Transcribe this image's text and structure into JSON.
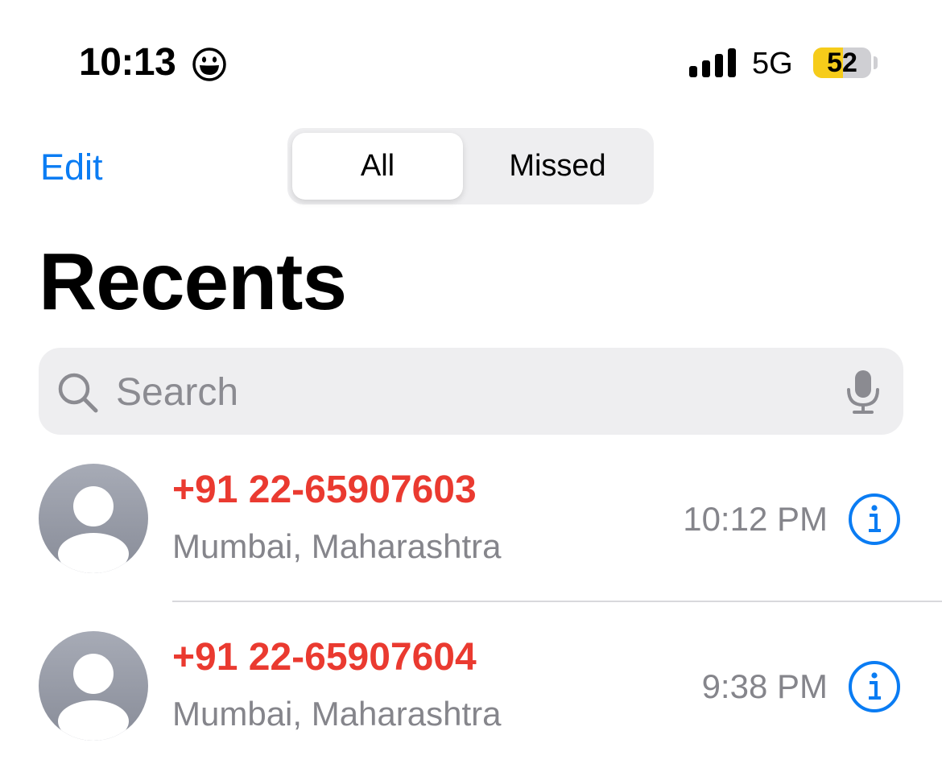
{
  "status_bar": {
    "time": "10:13",
    "status_emoji": "smiley-icon",
    "network": "5G",
    "battery": "52",
    "battery_level": 0.52
  },
  "nav": {
    "edit_label": "Edit",
    "segments": [
      {
        "label": "All",
        "selected": true
      },
      {
        "label": "Missed",
        "selected": false
      }
    ]
  },
  "title": "Recents",
  "search": {
    "placeholder": "Search",
    "icon": "search-icon",
    "mic_icon": "microphone-icon"
  },
  "calls": [
    {
      "number": "+91 22-65907603",
      "location": "Mumbai, Maharashtra",
      "time": "10:12 PM",
      "missed": true
    },
    {
      "number": "+91 22-65907604",
      "location": "Mumbai, Maharashtra",
      "time": "9:38 PM",
      "missed": true
    }
  ],
  "colors": {
    "accent": "#0a7cf3",
    "missed": "#ea3a30",
    "secondary_text": "#85858b",
    "battery_fill": "#f6cc1a",
    "search_bg": "#eeeef0"
  }
}
